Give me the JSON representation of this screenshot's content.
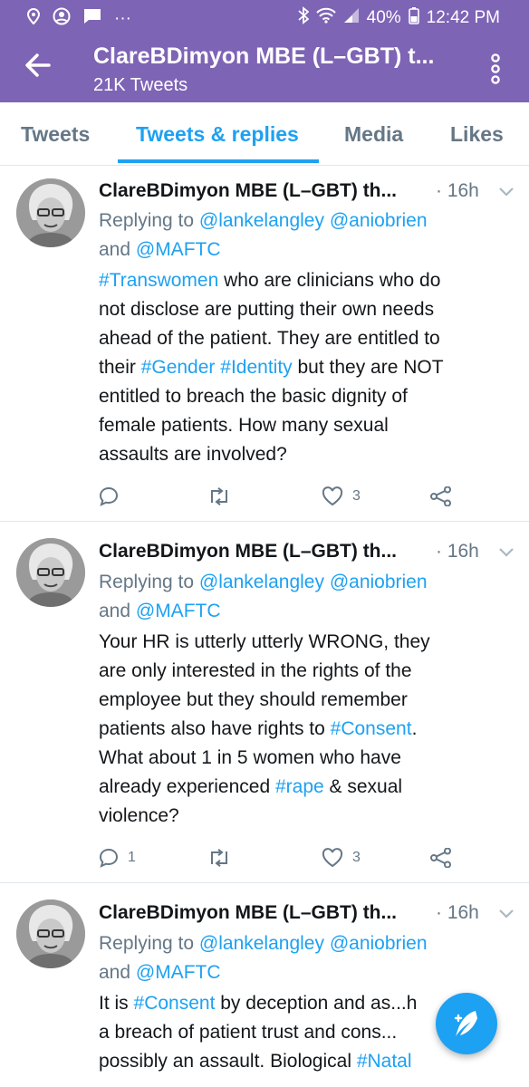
{
  "status_bar": {
    "battery": "40%",
    "time": "12:42 PM",
    "dots": "···"
  },
  "app_bar": {
    "title": "ClareBDimyon MBE (L–GBT) t...",
    "subtitle": "21K Tweets"
  },
  "tabs": [
    {
      "label": "Tweets"
    },
    {
      "label": "Tweets & replies"
    },
    {
      "label": "Media"
    },
    {
      "label": "Likes"
    }
  ],
  "tweets": [
    {
      "name": "ClareBDimyon MBE (L–GBT) th...",
      "time": "· 16h",
      "reply_prefix": "Replying to ",
      "reply_user1": "@lankelangley",
      "reply_user2": "@aniobrien",
      "reply_and": "and ",
      "reply_user3": "@MAFTC",
      "body": [
        {
          "tag": "#Transwomen",
          "text": " who are clinicians who do"
        },
        {
          "text": "not disclose are putting their own needs"
        },
        {
          "text": "ahead of the patient.  They are entitled to"
        },
        {
          "text": "their ",
          "tag": "#Gender",
          "tag2": "#Identity",
          "text2": " but they are NOT"
        },
        {
          "text": "entitled to breach the basic dignity of"
        },
        {
          "text": "female patients. How many sexual"
        },
        {
          "text": "assaults are involved?"
        }
      ],
      "reply_count": "",
      "like_count": "3"
    },
    {
      "name": "ClareBDimyon MBE (L–GBT) th...",
      "time": "· 16h",
      "reply_prefix": "Replying to ",
      "reply_user1": "@lankelangley",
      "reply_user2": "@aniobrien",
      "reply_and": "and ",
      "reply_user3": "@MAFTC",
      "body": [
        {
          "text": "Your HR is utterly utterly WRONG, they"
        },
        {
          "text": "are only interested in the rights of the"
        },
        {
          "text": "employee but they should remember"
        },
        {
          "text": "patients also have rights to ",
          "tag": "#Consent",
          "text2": "."
        },
        {
          "text": "What about 1 in 5 women who have"
        },
        {
          "text": "already experienced ",
          "tag": "#rape",
          "text2": " & sexual"
        },
        {
          "text": "violence?"
        }
      ],
      "reply_count": "1",
      "like_count": "3"
    },
    {
      "name": "ClareBDimyon MBE (L–GBT) th...",
      "time": "· 16h",
      "reply_prefix": "Replying to ",
      "reply_user1": "@lankelangley",
      "reply_user2": "@aniobrien",
      "reply_and": "and ",
      "reply_user3": "@MAFTC",
      "body": [
        {
          "text": "It is ",
          "tag": "#Consent",
          "text2": " by deception and as...h"
        },
        {
          "text": "a breach of patient trust and cons..."
        },
        {
          "text": "possibly an assault. Biological ",
          "tag": "#Natal"
        }
      ]
    }
  ],
  "colors": {
    "brand": "#7e64b5",
    "accent": "#1da1f2",
    "muted": "#657786"
  }
}
